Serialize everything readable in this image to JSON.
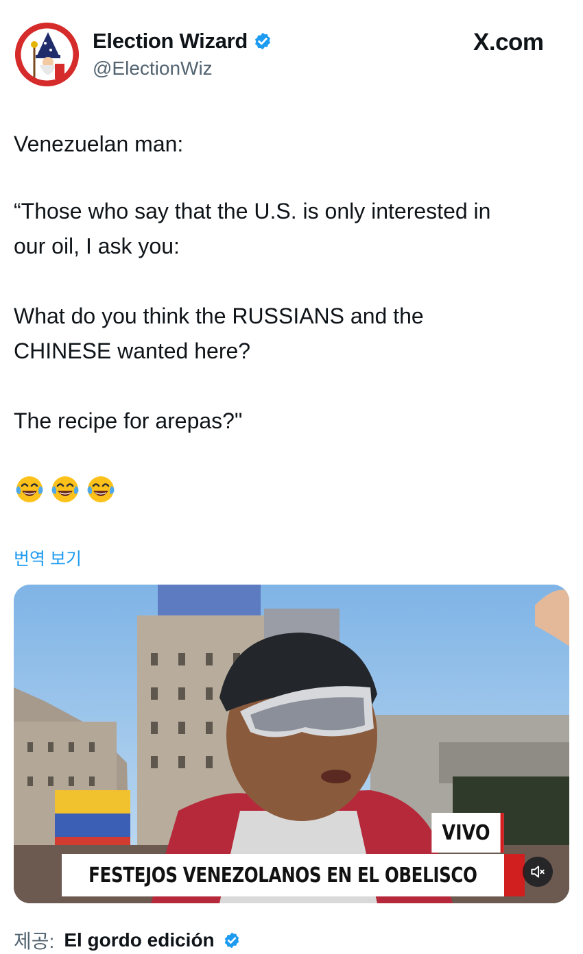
{
  "author": {
    "display_name": "Election Wizard",
    "handle": "@ElectionWiz",
    "verified": true
  },
  "source_site": "X.com",
  "tweet": {
    "lines": [
      "Venezuelan man:",
      "“Those who say that the U.S. is only interested in",
      "our oil, I ask you:",
      "What do you think the RUSSIANS and the",
      "CHINESE wanted here?",
      "The recipe for arepas?\""
    ],
    "emoji": [
      "face-with-tears-of-joy",
      "face-with-tears-of-joy",
      "face-with-tears-of-joy"
    ]
  },
  "translate_link": "번역 보기",
  "media": {
    "badge": "VIVO",
    "headline": "FESTEJOS VENEZOLANOS EN EL OBELISCO",
    "mute_icon": "speaker-muted-icon"
  },
  "credit": {
    "label": "제공:",
    "name": "El gordo edición",
    "verified": true
  },
  "colors": {
    "link": "#1d9bf0",
    "muted_text": "#536471",
    "verified_badge": "#1d9bf0",
    "avatar_bg": "#d62b2b",
    "broadcast_red": "#d11f1f"
  }
}
